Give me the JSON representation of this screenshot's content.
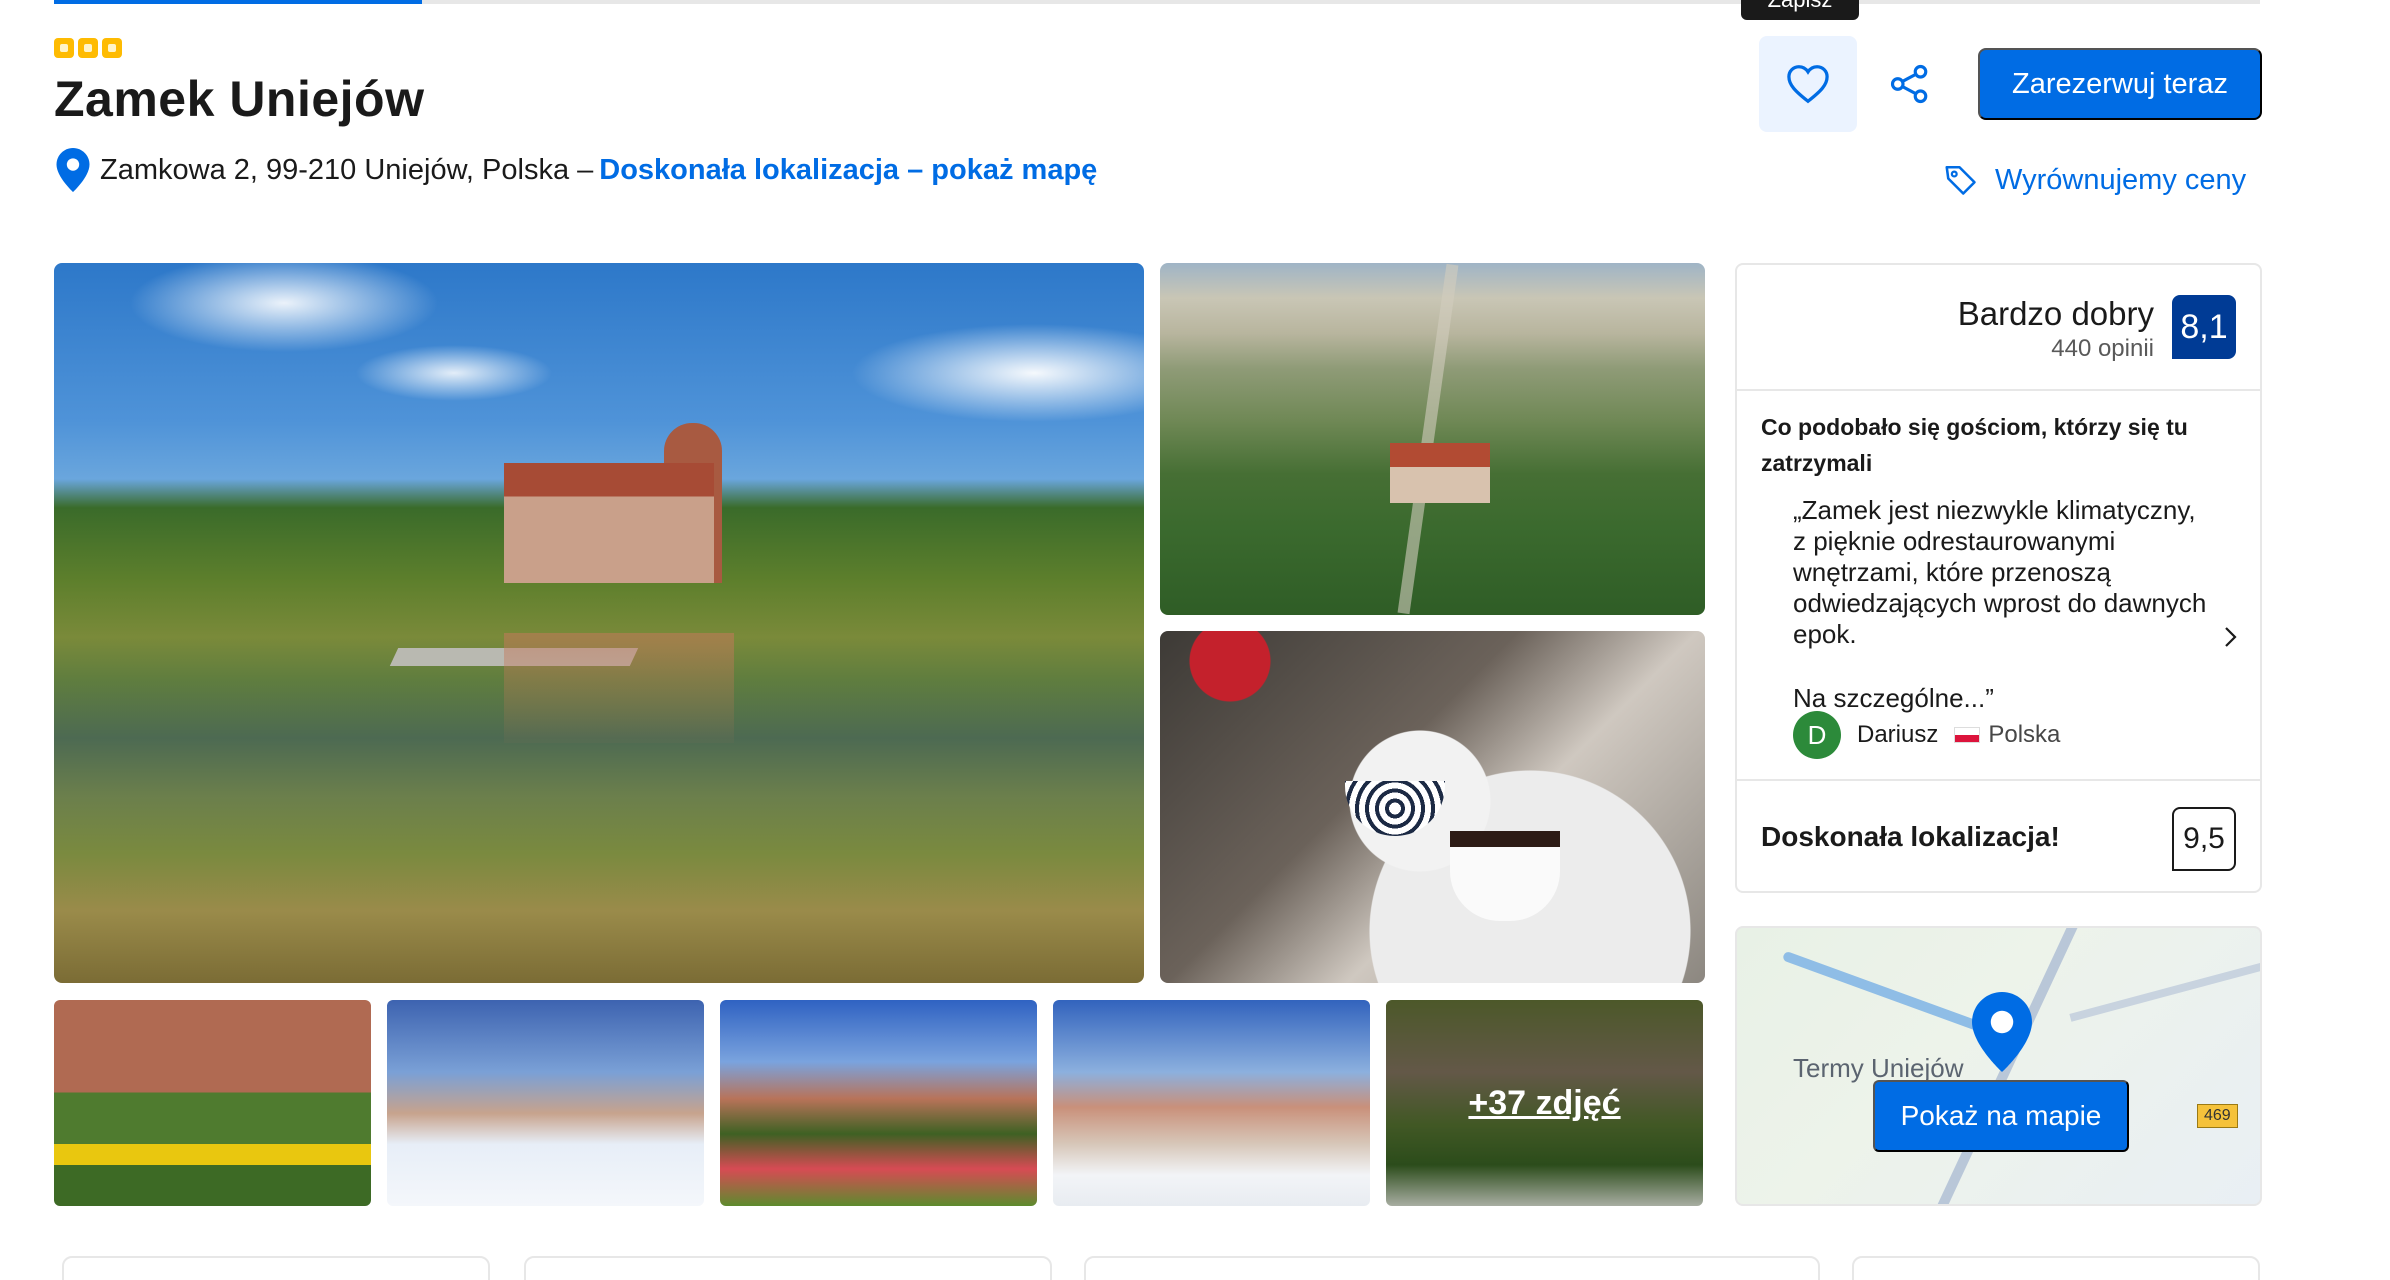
{
  "tooltip": {
    "text": "Zapisz"
  },
  "hotel": {
    "stars": 3,
    "title": "Zamek Uniejów",
    "address": "Zamkowa 2, 99-210 Uniejów, Polska –",
    "map_link": "Doskonała lokalizacja – pokaż mapę"
  },
  "actions": {
    "book_label": "Zarezerwuj teraz",
    "price_match_label": "Wyrównujemy ceny"
  },
  "photos": {
    "more_label": "+37 zdjęć"
  },
  "reviews": {
    "rating_word": "Bardzo dobry",
    "count_label": "440 opinii",
    "score": "8,1",
    "liked_heading": "Co podobało się gościom, którzy się tu zatrzymali",
    "quote": "„Zamek jest niezwykle klimatyczny, z pięknie odrestaurowanymi wnętrzami, które przenoszą odwiedzających wprost do dawnych epok.",
    "quote_more": "Na szczególne...”",
    "reviewer": {
      "initial": "D",
      "name": "Dariusz",
      "country": "Polska"
    },
    "location_label": "Doskonała lokalizacja!",
    "location_score": "9,5"
  },
  "map": {
    "place_label": "Termy Uniejów",
    "road_number": "469",
    "button_label": "Pokaż na mapie"
  },
  "colors": {
    "accent": "#006ce4",
    "score_badge": "#003b95",
    "stars": "#febb02"
  },
  "icons": [
    "map-pin-icon",
    "heart-icon",
    "share-icon",
    "price-tag-icon",
    "chevron-right-icon",
    "flag-icon"
  ]
}
